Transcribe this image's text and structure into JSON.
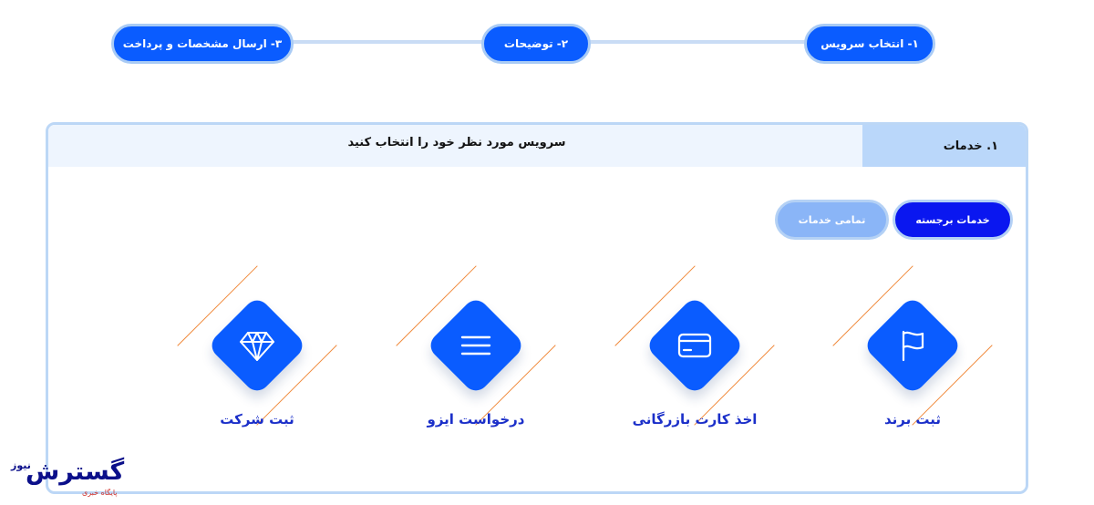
{
  "stepper": {
    "steps": [
      {
        "label": "۱- انتخاب سرویس"
      },
      {
        "label": "۲- توضیحات"
      },
      {
        "label": "۳- ارسال مشخصات و پرداخت"
      }
    ]
  },
  "section": {
    "title": "۱. خدمات",
    "description": "سرویس مورد نظر خود را انتخاب کنید"
  },
  "filters": {
    "featured_label": "خدمات برجسته",
    "all_label": "تمامی خدمات"
  },
  "services": [
    {
      "label": "ثبت برند",
      "icon": "flag-icon"
    },
    {
      "label": "اخذ کارت بازرگانی",
      "icon": "credit-card-icon"
    },
    {
      "label": "درخواست ایزو",
      "icon": "menu-lines-icon"
    },
    {
      "label": "ثبت شرکت",
      "icon": "diamond-gem-icon"
    }
  ],
  "logo": {
    "main": "گسترش",
    "suffix": "نیوز",
    "subtitle": "پایگاه خبری"
  },
  "colors": {
    "primary": "#0a5cff",
    "featured_tab": "#0a17f0",
    "inactive_tab": "#8ab5f7",
    "accent_line": "#f08a3c",
    "label_blue": "#1b2fc9"
  }
}
